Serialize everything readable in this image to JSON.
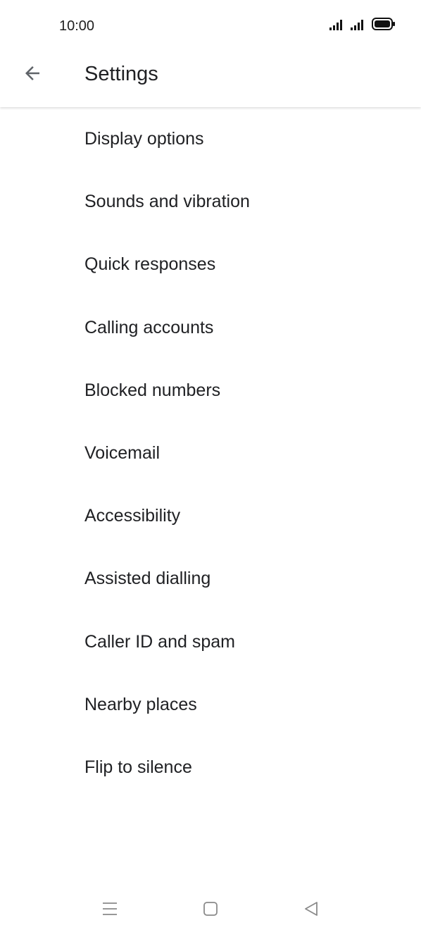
{
  "status_bar": {
    "time": "10:00",
    "icons": [
      "signal-icon",
      "signal-icon",
      "battery-icon"
    ]
  },
  "app_bar": {
    "back_icon": "arrow-back-icon",
    "title": "Settings"
  },
  "settings": {
    "items": [
      {
        "label": "Display options"
      },
      {
        "label": "Sounds and vibration"
      },
      {
        "label": "Quick responses"
      },
      {
        "label": "Calling accounts"
      },
      {
        "label": "Blocked numbers"
      },
      {
        "label": "Voicemail"
      },
      {
        "label": "Accessibility"
      },
      {
        "label": "Assisted dialling"
      },
      {
        "label": "Caller ID and spam"
      },
      {
        "label": "Nearby places"
      },
      {
        "label": "Flip to silence"
      }
    ]
  },
  "nav_bar": {
    "icons": [
      "menu-icon",
      "home-square-icon",
      "back-triangle-icon"
    ]
  },
  "colors": {
    "text": "#202124",
    "icon": "#5f6368",
    "background": "#ffffff"
  }
}
